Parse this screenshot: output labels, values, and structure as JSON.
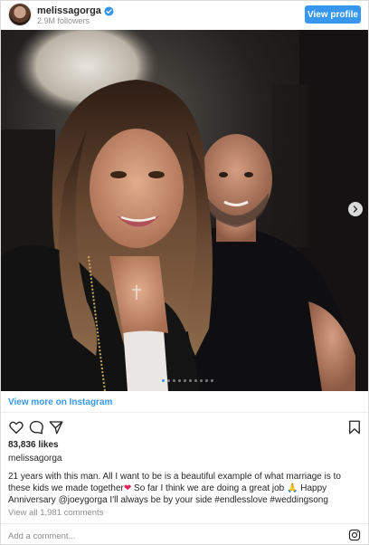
{
  "header": {
    "username": "melissagorga",
    "followers": "2.9M followers",
    "view_profile_label": "View profile"
  },
  "post": {
    "carousel": {
      "total_slides": 10,
      "active_slide": 1
    },
    "view_more_label": "View more on Instagram",
    "likes": "83,836 likes",
    "poster_username": "melissagorga",
    "caption_part1": "21 years with this man. All I want to be is a beautiful example of what marriage is to these kids we made together",
    "caption_heart": "❤",
    "caption_part2": "  So far I think we are doing a great job ",
    "caption_emoji": "🙏",
    "caption_part3": " Happy Anniversary @joeygorga I'll always be by your side ",
    "hashtags": "#endlesslove #weddingsong",
    "comments_label": "View all 1,981 comments",
    "add_comment_placeholder": "Add a comment..."
  },
  "icons": {
    "verified": "verified-badge-icon",
    "next": "chevron-right-icon",
    "like": "heart-icon",
    "comment": "comment-icon",
    "share": "share-icon",
    "save": "bookmark-icon",
    "instagram": "instagram-icon"
  },
  "colors": {
    "link_blue": "#3897f0",
    "muted_gray": "#8e8e8e",
    "text_dark": "#262626"
  }
}
